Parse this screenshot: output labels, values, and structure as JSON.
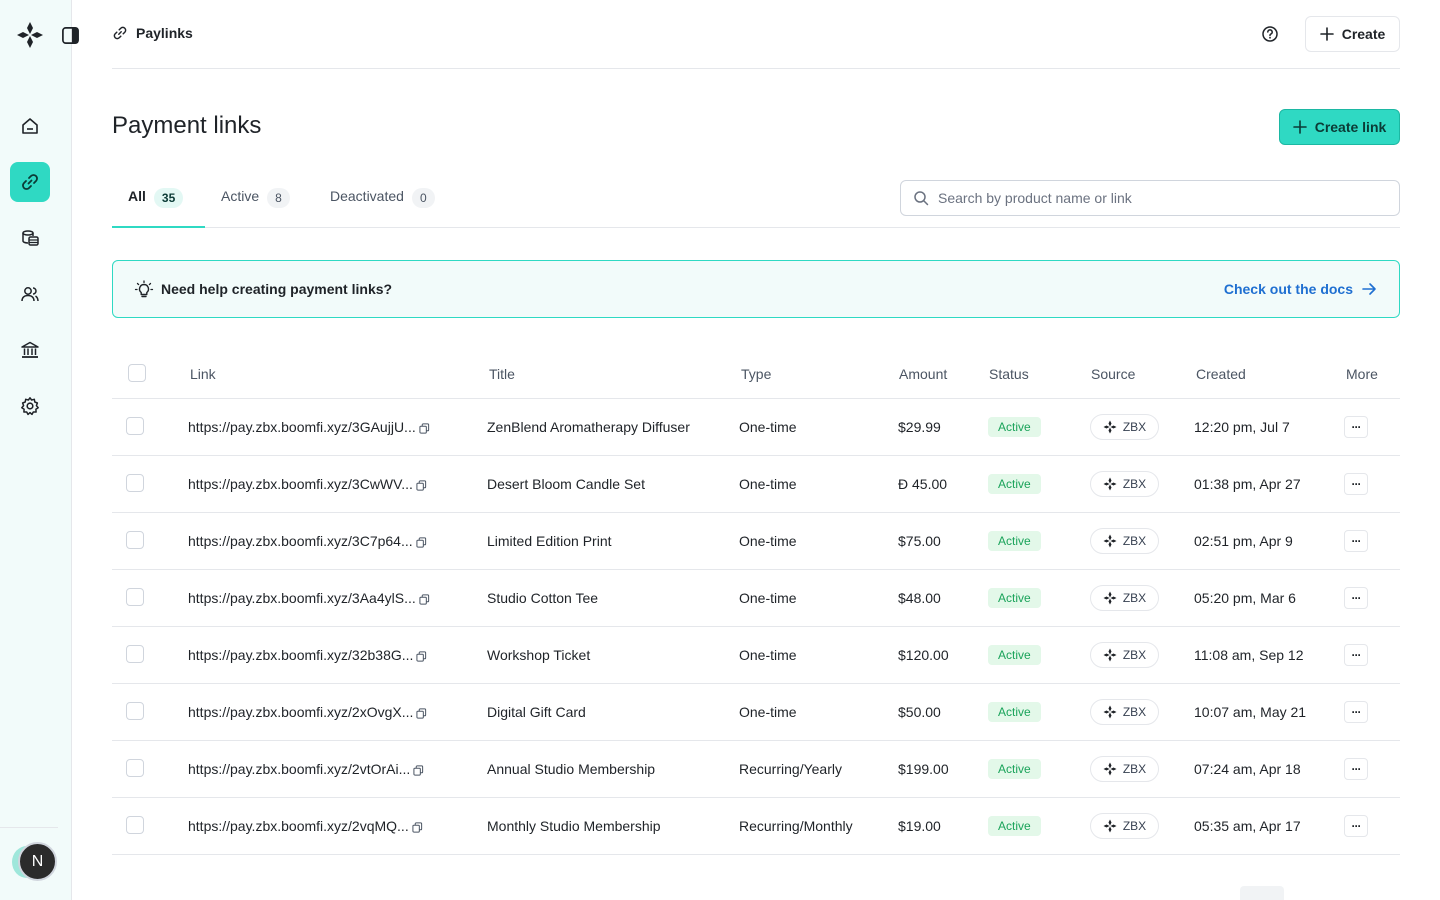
{
  "sidebar": {
    "nav": [
      "home-icon",
      "link-icon",
      "coins-icon",
      "users-icon",
      "bank-icon",
      "gear-icon"
    ],
    "avatar_initial": "N"
  },
  "topbar": {
    "breadcrumb": "Paylinks",
    "create_label": "Create"
  },
  "header": {
    "title": "Payment links",
    "create_link_label": "Create link"
  },
  "tabs": [
    {
      "label": "All",
      "count": "35"
    },
    {
      "label": "Active",
      "count": "8"
    },
    {
      "label": "Deactivated",
      "count": "0"
    }
  ],
  "search": {
    "placeholder": "Search by product name or link"
  },
  "banner": {
    "text": "Need help creating payment links?",
    "link": "Check out the docs"
  },
  "table": {
    "headers": [
      "Link",
      "Title",
      "Type",
      "Amount",
      "Status",
      "Source",
      "Created",
      "More"
    ],
    "rows": [
      {
        "link": "https://pay.zbx.boomfi.xyz/3GAujjU...",
        "title": "ZenBlend Aromatherapy Diffuser",
        "type": "One-time",
        "amount": "$29.99",
        "status": "Active",
        "source": "ZBX",
        "created": "12:20 pm, Jul 7"
      },
      {
        "link": "https://pay.zbx.boomfi.xyz/3CwWV...",
        "title": "Desert Bloom Candle Set",
        "type": "One-time",
        "amount": "Đ 45.00",
        "status": "Active",
        "source": "ZBX",
        "created": "01:38 pm, Apr 27"
      },
      {
        "link": "https://pay.zbx.boomfi.xyz/3C7p64...",
        "title": "Limited Edition Print",
        "type": "One-time",
        "amount": "$75.00",
        "status": "Active",
        "source": "ZBX",
        "created": "02:51 pm, Apr 9"
      },
      {
        "link": "https://pay.zbx.boomfi.xyz/3Aa4ylS...",
        "title": "Studio Cotton Tee",
        "type": "One-time",
        "amount": "$48.00",
        "status": "Active",
        "source": "ZBX",
        "created": "05:20 pm, Mar 6"
      },
      {
        "link": "https://pay.zbx.boomfi.xyz/32b38G...",
        "title": "Workshop Ticket",
        "type": "One-time",
        "amount": "$120.00",
        "status": "Active",
        "source": "ZBX",
        "created": "11:08 am, Sep 12"
      },
      {
        "link": "https://pay.zbx.boomfi.xyz/2xOvgX...",
        "title": "Digital Gift Card",
        "type": "One-time",
        "amount": "$50.00",
        "status": "Active",
        "source": "ZBX",
        "created": "10:07 am, May 21"
      },
      {
        "link": "https://pay.zbx.boomfi.xyz/2vtOrAi...",
        "title": "Annual Studio Membership",
        "type": "Recurring/Yearly",
        "amount": "$199.00",
        "status": "Active",
        "source": "ZBX",
        "created": "07:24 am, Apr 18"
      },
      {
        "link": "https://pay.zbx.boomfi.xyz/2vqMQ...",
        "title": "Monthly Studio Membership",
        "type": "Recurring/Monthly",
        "amount": "$19.00",
        "status": "Active",
        "source": "ZBX",
        "created": "05:35 am, Apr 17"
      }
    ]
  },
  "colors": {
    "accent": "#2fd9c3",
    "status_active_bg": "#e3f8e9",
    "status_active_text": "#1aa35a",
    "docs_link": "#1f6fd1"
  }
}
